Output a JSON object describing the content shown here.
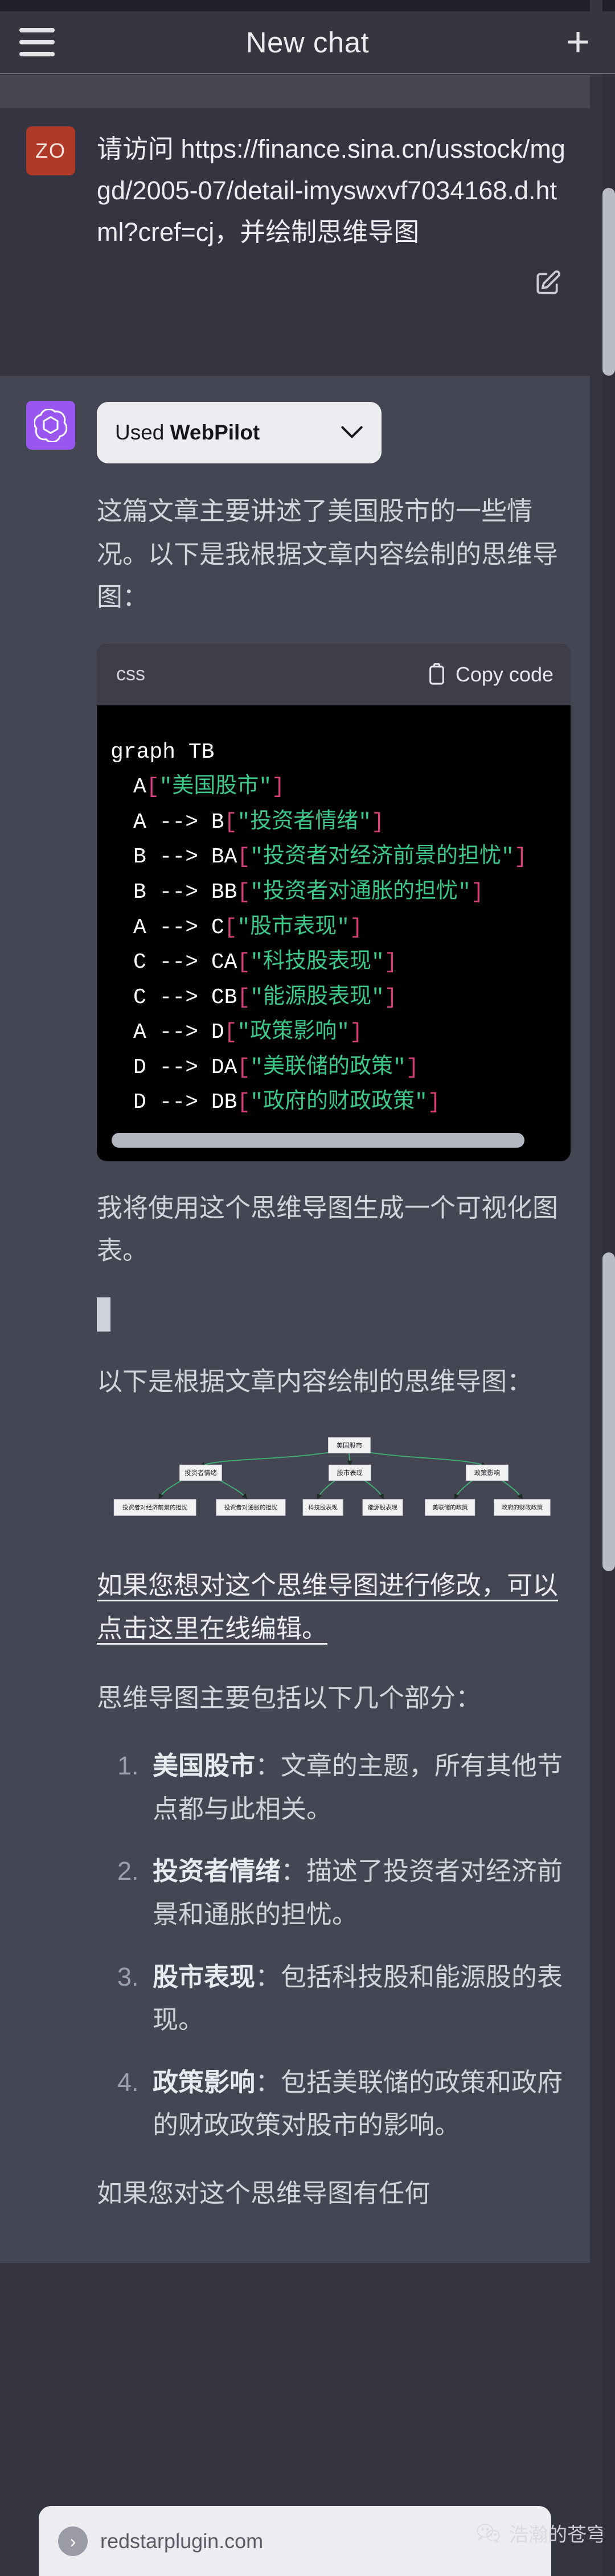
{
  "header": {
    "title": "New chat",
    "menu_icon": "hamburger-icon",
    "new_chat_icon": "plus-icon"
  },
  "user_message": {
    "avatar_initials": "ZO",
    "text": "请访问 https://finance.sina.cn/usstock/mggd/2005-07/detail-imyswxvf7034168.d.html?cref=cj，并绘制思维导图",
    "edit_icon": "edit-pencil-icon"
  },
  "assistant_message": {
    "plugin": {
      "prefix": "Used ",
      "name": "WebPilot",
      "chevron": "chevron-down-icon"
    },
    "intro_paragraph": "这篇文章主要讲述了美国股市的一些情况。以下是我根据文章内容绘制的思维导图：",
    "code_block": {
      "language": "css",
      "copy_label": "Copy code",
      "copy_icon": "clipboard-icon",
      "lines": [
        {
          "indent": false,
          "tokens": [
            {
              "t": "graph TB",
              "c": "plain"
            }
          ]
        },
        {
          "indent": true,
          "tokens": [
            {
              "t": "A",
              "c": "id"
            },
            {
              "t": "[",
              "c": "br"
            },
            {
              "t": "\"美国股市\"",
              "c": "str"
            },
            {
              "t": "]",
              "c": "br"
            }
          ]
        },
        {
          "indent": true,
          "tokens": [
            {
              "t": "A --> B",
              "c": "id"
            },
            {
              "t": "[",
              "c": "br"
            },
            {
              "t": "\"投资者情绪\"",
              "c": "str"
            },
            {
              "t": "]",
              "c": "br"
            }
          ]
        },
        {
          "indent": true,
          "tokens": [
            {
              "t": "B --> BA",
              "c": "id"
            },
            {
              "t": "[",
              "c": "br"
            },
            {
              "t": "\"投资者对经济前景的担忧\"",
              "c": "str"
            },
            {
              "t": "]",
              "c": "br"
            }
          ]
        },
        {
          "indent": true,
          "tokens": [
            {
              "t": "B --> BB",
              "c": "id"
            },
            {
              "t": "[",
              "c": "br"
            },
            {
              "t": "\"投资者对通胀的担忧\"",
              "c": "str"
            },
            {
              "t": "]",
              "c": "br"
            }
          ]
        },
        {
          "indent": true,
          "tokens": [
            {
              "t": "A --> C",
              "c": "id"
            },
            {
              "t": "[",
              "c": "br"
            },
            {
              "t": "\"股市表现\"",
              "c": "str"
            },
            {
              "t": "]",
              "c": "br"
            }
          ]
        },
        {
          "indent": true,
          "tokens": [
            {
              "t": "C --> CA",
              "c": "id"
            },
            {
              "t": "[",
              "c": "br"
            },
            {
              "t": "\"科技股表现\"",
              "c": "str"
            },
            {
              "t": "]",
              "c": "br"
            }
          ]
        },
        {
          "indent": true,
          "tokens": [
            {
              "t": "C --> CB",
              "c": "id"
            },
            {
              "t": "[",
              "c": "br"
            },
            {
              "t": "\"能源股表现\"",
              "c": "str"
            },
            {
              "t": "]",
              "c": "br"
            }
          ]
        },
        {
          "indent": true,
          "tokens": [
            {
              "t": "A --> D",
              "c": "id"
            },
            {
              "t": "[",
              "c": "br"
            },
            {
              "t": "\"政策影响\"",
              "c": "str"
            },
            {
              "t": "]",
              "c": "br"
            }
          ]
        },
        {
          "indent": true,
          "tokens": [
            {
              "t": "D --> DA",
              "c": "id"
            },
            {
              "t": "[",
              "c": "br"
            },
            {
              "t": "\"美联储的政策\"",
              "c": "str"
            },
            {
              "t": "]",
              "c": "br"
            }
          ]
        },
        {
          "indent": true,
          "tokens": [
            {
              "t": "D --> DB",
              "c": "id"
            },
            {
              "t": "[",
              "c": "br"
            },
            {
              "t": "\"政府的财政政策\"",
              "c": "str"
            },
            {
              "t": "]",
              "c": "br"
            }
          ]
        }
      ]
    },
    "paragraph_visualize": "我将使用这个思维导图生成一个可视化图表。",
    "paragraph_below": "以下是根据文章内容绘制的思维导图：",
    "edit_link_text": "如果您想对这个思维导图进行修改，可以点击这里在线编辑。",
    "sections_intro": "思维导图主要包括以下几个部分：",
    "sections": [
      {
        "title": "美国股市",
        "body": "：文章的主题，所有其他节点都与此相关。"
      },
      {
        "title": "投资者情绪",
        "body": "：描述了投资者对经济前景和通胀的担忧。"
      },
      {
        "title": "股市表现",
        "body": "：包括科技股和能源股的表现。"
      },
      {
        "title": "政策影响",
        "body": "：包括美联储的政策和政府的财政政策对股市的影响。"
      }
    ],
    "closing_paragraph": "如果您对这个思维导图有任何"
  },
  "mindmap": {
    "root": "美国股市",
    "branches": [
      {
        "label": "投资者情绪",
        "children": [
          "投资者对经济前景的担忧",
          "投资者对通胀的担忧"
        ]
      },
      {
        "label": "股市表现",
        "children": [
          "科技股表现",
          "能源股表现"
        ]
      },
      {
        "label": "政策影响",
        "children": [
          "美联储的政策",
          "政府的财政政策"
        ]
      }
    ],
    "edge_color": "#3fae74",
    "node_fill": "#f2f2f5"
  },
  "composer": {
    "url_text": "redstarplugin.com",
    "badge_icon": "chevron-right-icon"
  },
  "watermark": {
    "text": "浩瀚的苍穹",
    "icon": "wechat-icon"
  },
  "colors": {
    "bg": "#343541",
    "bot_bg": "#444654",
    "header_bg": "#353640",
    "user_avatar": "#b03a28",
    "bot_avatar": "#9a57f0",
    "code_bg": "#000000",
    "accent_green": "#3ec98a",
    "accent_pink": "#d4407a"
  }
}
